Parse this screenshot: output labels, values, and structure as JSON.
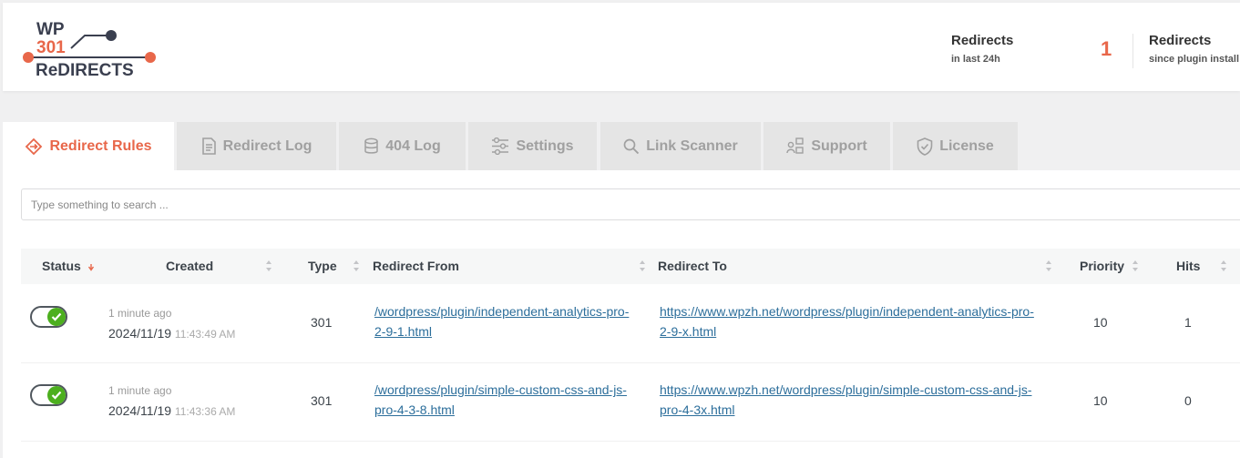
{
  "logo": {
    "line1": "WP",
    "line2": "301",
    "line3": "ReDIRECTS"
  },
  "stats": {
    "last24": {
      "label": "Redirects",
      "sub": "in last 24h"
    },
    "count": "1",
    "total": {
      "label": "Redirects",
      "sub": "since plugin install"
    }
  },
  "tabs": [
    {
      "label": "Redirect Rules",
      "icon": "redirect-icon",
      "active": true
    },
    {
      "label": "Redirect Log",
      "icon": "document-icon"
    },
    {
      "label": "404 Log",
      "icon": "database-icon"
    },
    {
      "label": "Settings",
      "icon": "sliders-icon"
    },
    {
      "label": "Link Scanner",
      "icon": "search-icon"
    },
    {
      "label": "Support",
      "icon": "support-icon"
    },
    {
      "label": "License",
      "icon": "shield-icon"
    }
  ],
  "search": {
    "placeholder": "Type something to search ..."
  },
  "columns": {
    "status": "Status",
    "created": "Created",
    "type": "Type",
    "from": "Redirect From",
    "to": "Redirect To",
    "priority": "Priority",
    "hits": "Hits"
  },
  "rows": [
    {
      "ago": "1 minute ago",
      "date": "2024/11/19",
      "time": "11:43:49 AM",
      "type": "301",
      "from1": "/wordpress/plugin/independent-analytics-pro-",
      "from2": "2-9-1.html",
      "to1": "https://www.wpzh.net/wordpress/plugin/independent-analytics-pro-",
      "to2": "2-9-x.html",
      "priority": "10",
      "hits": "1"
    },
    {
      "ago": "1 minute ago",
      "date": "2024/11/19",
      "time": "11:43:36 AM",
      "type": "301",
      "from1": "/wordpress/plugin/simple-custom-css-and-js-",
      "from2": "pro-4-3-8.html",
      "to1": "https://www.wpzh.net/wordpress/plugin/simple-custom-css-and-js-",
      "to2": "pro-4-3x.html",
      "priority": "10",
      "hits": "0"
    }
  ],
  "colors": {
    "accent": "#e8674a",
    "link": "#2c6e9b",
    "toggle_on": "#4caf1e"
  }
}
